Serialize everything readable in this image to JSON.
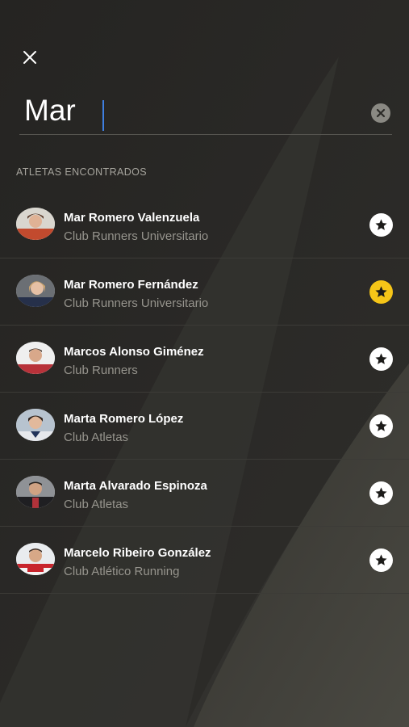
{
  "colors": {
    "background": "#2b2a27",
    "text_primary": "#ffffff",
    "text_secondary": "#96948d",
    "favorite_active": "#f5c518",
    "favorite_inactive": "#ffffff",
    "caret": "#3f7fe0"
  },
  "header": {
    "close_icon": "close-icon"
  },
  "search": {
    "value": "Mar",
    "clear_icon": "clear-circle-icon"
  },
  "section_label": "ATLETAS ENCONTRADOS",
  "athletes": [
    {
      "name": "Mar Romero Valenzuela",
      "club": "Club Runners Universitario",
      "favorite": false
    },
    {
      "name": "Mar Romero Fernández",
      "club": "Club Runners Universitario",
      "favorite": true
    },
    {
      "name": "Marcos Alonso Giménez",
      "club": "Club Runners",
      "favorite": false
    },
    {
      "name": "Marta Romero López",
      "club": "Club Atletas",
      "favorite": false
    },
    {
      "name": "Marta Alvarado Espinoza",
      "club": "Club Atletas",
      "favorite": false
    },
    {
      "name": "Marcelo Ribeiro González",
      "club": "Club Atlético Running",
      "favorite": false
    }
  ]
}
